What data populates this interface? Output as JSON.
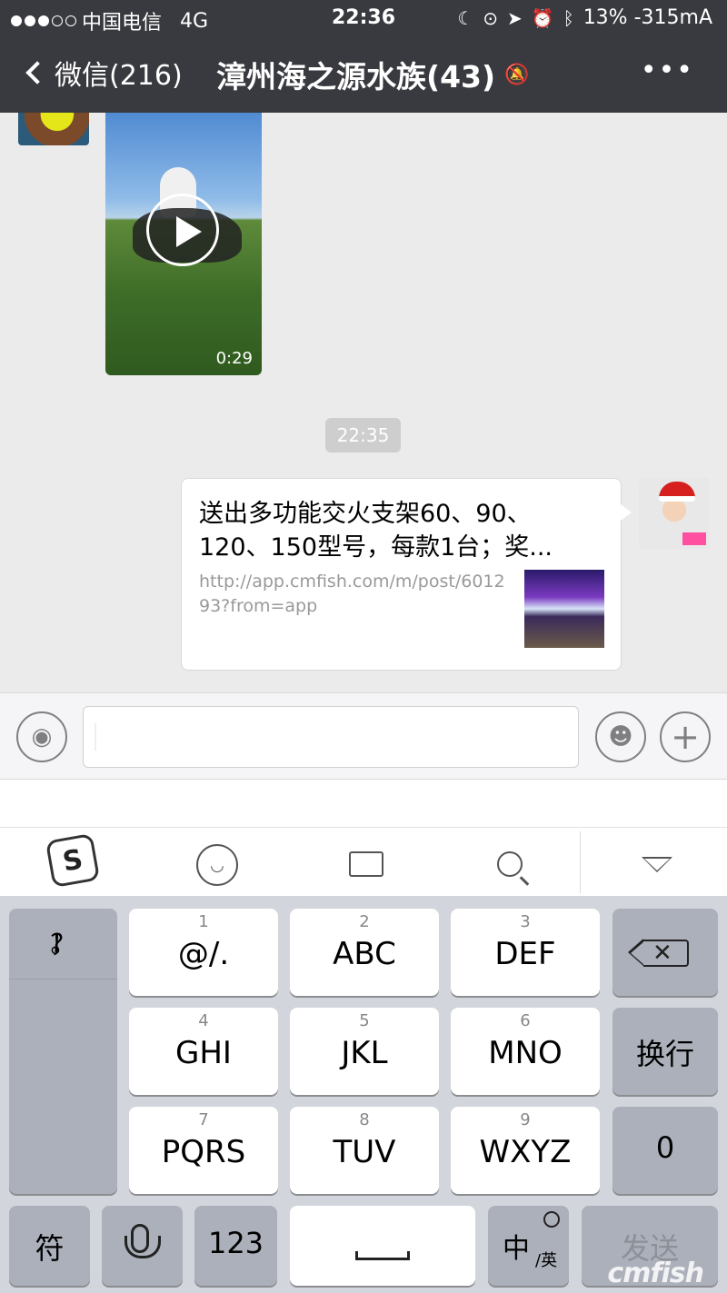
{
  "status_bar": {
    "carrier": "中国电信",
    "network": "4G",
    "time": "22:36",
    "battery": "13% -315mA",
    "icons": [
      "moon-icon",
      "rotation-lock-icon",
      "location-icon",
      "alarm-icon",
      "bluetooth-icon"
    ]
  },
  "nav": {
    "back_label": "微信(216)",
    "title": "漳州海之源水族(43)",
    "more_label": "•••"
  },
  "chat": {
    "video_duration": "0:29",
    "timestamp": "22:35",
    "link_card": {
      "title": "送出多功能交火支架60、90、120、150型号，每款1台；奖...",
      "url": "http://app.cmfish.com/m/post/601293?from=app"
    }
  },
  "keyboard": {
    "punctuation": [
      "，",
      "。",
      "？",
      "！"
    ],
    "keys": [
      {
        "num": "1",
        "label": "@/."
      },
      {
        "num": "2",
        "label": "ABC"
      },
      {
        "num": "3",
        "label": "DEF"
      },
      {
        "num": "4",
        "label": "GHI"
      },
      {
        "num": "5",
        "label": "JKL"
      },
      {
        "num": "6",
        "label": "MNO"
      },
      {
        "num": "7",
        "label": "PQRS"
      },
      {
        "num": "8",
        "label": "TUV"
      },
      {
        "num": "9",
        "label": "WXYZ"
      }
    ],
    "newline_label": "换行",
    "zero_label": "0",
    "symbol_label": "符",
    "numeric_label": "123",
    "lang_main": "中",
    "lang_alt": "/英",
    "send_label": "发送",
    "watermark": "cmfish"
  },
  "colors": {
    "nav_bg": "#393a3f",
    "chat_bg": "#ebebeb",
    "keyboard_bg": "#d2d5db"
  }
}
